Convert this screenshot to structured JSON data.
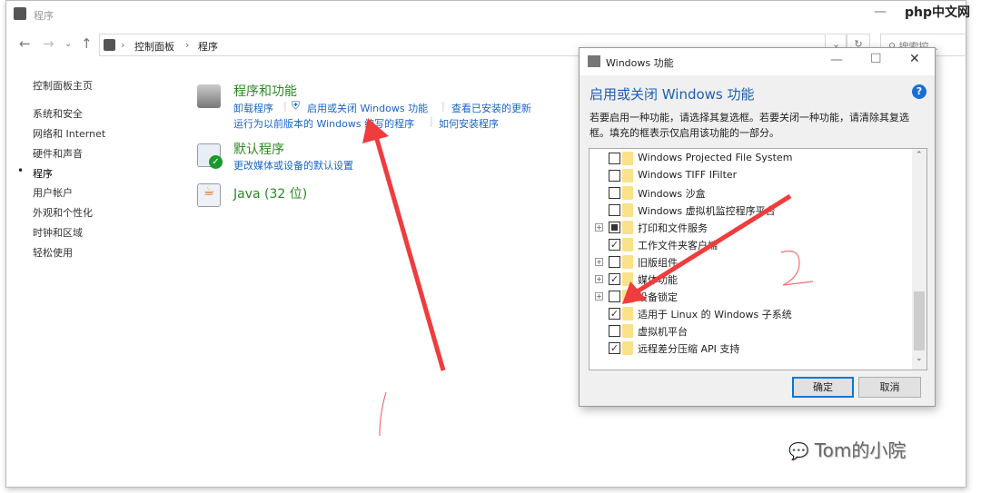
{
  "window": {
    "title": "程序",
    "breadcrumb": [
      "控制面板",
      "程序"
    ],
    "search_placeholder": "搜索控..."
  },
  "sidebar": {
    "items": [
      {
        "label": "控制面板主页"
      },
      {
        "label": "系统和安全"
      },
      {
        "label": "网络和 Internet"
      },
      {
        "label": "硬件和声音"
      },
      {
        "label": "程序",
        "active": true
      },
      {
        "label": "用户帐户"
      },
      {
        "label": "外观和个性化"
      },
      {
        "label": "时钟和区域"
      },
      {
        "label": "轻松使用"
      }
    ]
  },
  "main": {
    "programs": {
      "title": "程序和功能",
      "links": [
        "卸载程序",
        "启用或关闭 Windows 功能",
        "查看已安装的更新",
        "运行为以前版本的 Windows 编写的程序",
        "如何安装程序"
      ]
    },
    "defaults": {
      "title": "默认程序",
      "links": [
        "更改媒体或设备的默认设置"
      ]
    },
    "java": {
      "title": "Java (32 位)"
    }
  },
  "dialog": {
    "title": "Windows 功能",
    "heading": "启用或关闭 Windows 功能",
    "description": "若要启用一种功能，请选择其复选框。若要关闭一种功能，请清除其复选框。填充的框表示仅启用该功能的一部分。",
    "features": [
      {
        "label": "Windows Projected File System",
        "state": "unchecked",
        "expandable": false
      },
      {
        "label": "Windows TIFF IFilter",
        "state": "unchecked",
        "expandable": false
      },
      {
        "label": "Windows 沙盒",
        "state": "unchecked",
        "expandable": false
      },
      {
        "label": "Windows 虚拟机监控程序平台",
        "state": "unchecked",
        "expandable": false
      },
      {
        "label": "打印和文件服务",
        "state": "partial",
        "expandable": true
      },
      {
        "label": "工作文件夹客户端",
        "state": "checked",
        "expandable": false
      },
      {
        "label": "旧版组件",
        "state": "unchecked",
        "expandable": true
      },
      {
        "label": "媒体功能",
        "state": "checked",
        "expandable": true
      },
      {
        "label": "设备锁定",
        "state": "unchecked",
        "expandable": true
      },
      {
        "label": "适用于 Linux 的 Windows 子系统",
        "state": "checked",
        "expandable": false
      },
      {
        "label": "虚拟机平台",
        "state": "unchecked",
        "expandable": false
      },
      {
        "label": "远程差分压缩 API 支持",
        "state": "checked",
        "expandable": false
      }
    ],
    "ok_label": "确定",
    "cancel_label": "取消"
  },
  "watermark": "Tom的小院",
  "site_logo": "php中文网",
  "colors": {
    "accent": "#1a66c4",
    "heading_green": "#2a8a22",
    "arrow": "#f03c3c"
  }
}
